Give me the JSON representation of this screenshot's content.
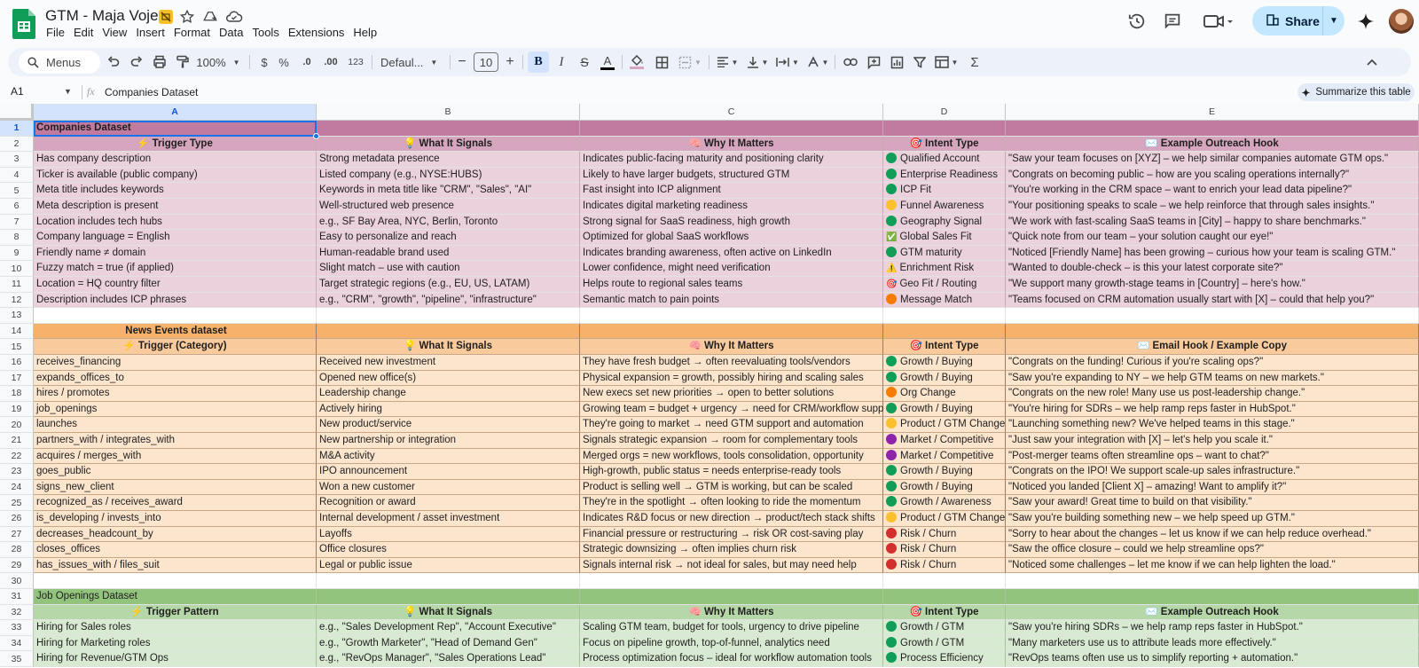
{
  "app": {
    "doc_title": "GTM - Maja Voje",
    "menu": [
      "File",
      "Edit",
      "View",
      "Insert",
      "Format",
      "Data",
      "Tools",
      "Extensions",
      "Help"
    ],
    "share_label": "Share"
  },
  "toolbar": {
    "search_label": "Menus",
    "zoom": "100%",
    "currency": "$",
    "percent": "%",
    "dec_decrease": ".0",
    "dec_increase": ".00",
    "number_format": "123",
    "font_name": "Defaul...",
    "font_size": "10",
    "bold": "B",
    "italic": "I",
    "strike": "S",
    "text_color": "A"
  },
  "formula_bar": {
    "cell_ref": "A1",
    "fx": "fx",
    "content": "Companies Dataset",
    "summarize_label": "Summarize this table"
  },
  "columns": [
    "A",
    "B",
    "C",
    "D",
    "E"
  ],
  "colors": {
    "green_dot": "#0f9d58",
    "orange_dot": "#f57c00",
    "yellow_dot": "#fbc02d",
    "purple_dot": "#8e24aa",
    "red_dot": "#d32f2f",
    "selection": "#1a73e8"
  },
  "rows": [
    {
      "n": "1",
      "style": "sec-pink title",
      "cells": [
        "Companies Dataset",
        "",
        "",
        "",
        ""
      ],
      "bold_first": true
    },
    {
      "n": "2",
      "style": "sec-pink head",
      "cells": [
        "⚡ Trigger Type",
        "💡 What It Signals",
        "🧠 Why It Matters",
        "🎯 Intent Type",
        "✉️ Example Outreach Hook"
      ],
      "header": true
    },
    {
      "n": "3",
      "style": "sec-pink",
      "cells": [
        "Has company description",
        "Strong metadata presence",
        "Indicates public-facing maturity and positioning clarity",
        "Qualified Account",
        "\"Saw your team focuses on [XYZ] – we help similar companies automate GTM ops.\""
      ],
      "dot": "green"
    },
    {
      "n": "4",
      "style": "sec-pink",
      "cells": [
        "Ticker is available (public company)",
        "Listed company (e.g., NYSE:HUBS)",
        "Likely to have larger budgets, structured GTM",
        "Enterprise Readiness",
        "\"Congrats on becoming public – how are you scaling operations internally?\""
      ],
      "dot": "green"
    },
    {
      "n": "5",
      "style": "sec-pink",
      "cells": [
        "Meta title includes keywords",
        "Keywords in meta title like \"CRM\", \"Sales\", \"AI\"",
        "Fast insight into ICP alignment",
        "ICP Fit",
        "\"You're working in the CRM space – want to enrich your lead data pipeline?\""
      ],
      "dot": "green"
    },
    {
      "n": "6",
      "style": "sec-pink",
      "cells": [
        "Meta description is present",
        "Well-structured web presence",
        "Indicates digital marketing readiness",
        "Funnel Awareness",
        "\"Your positioning speaks to scale – we help reinforce that through sales insights.\""
      ],
      "dot": "yellow"
    },
    {
      "n": "7",
      "style": "sec-pink",
      "cells": [
        "Location includes tech hubs",
        "e.g., SF Bay Area, NYC, Berlin, Toronto",
        "Strong signal for SaaS readiness, high growth",
        "Geography Signal",
        "\"We work with fast-scaling SaaS teams in [City] – happy to share benchmarks.\""
      ],
      "dot": "green"
    },
    {
      "n": "8",
      "style": "sec-pink",
      "cells": [
        "Company language = English",
        "Easy to personalize and reach",
        "Optimized for global SaaS workflows",
        "Global Sales Fit",
        "\"Quick note from our team – your solution caught our eye!\""
      ],
      "emoji": "✅"
    },
    {
      "n": "9",
      "style": "sec-pink",
      "cells": [
        "Friendly name ≠ domain",
        "Human-readable brand used",
        "Indicates branding awareness, often active on LinkedIn",
        "GTM maturity",
        "\"Noticed [Friendly Name] has been growing – curious how your team is scaling GTM.\""
      ],
      "dot": "green"
    },
    {
      "n": "10",
      "style": "sec-pink",
      "cells": [
        "Fuzzy match = true (if applied)",
        "Slight match – use with caution",
        "Lower confidence, might need verification",
        "Enrichment Risk",
        "\"Wanted to double-check – is this your latest corporate site?\""
      ],
      "emoji": "⚠️"
    },
    {
      "n": "11",
      "style": "sec-pink",
      "cells": [
        "Location = HQ country filter",
        "Target strategic regions (e.g., EU, US, LATAM)",
        "Helps route to regional sales teams",
        "Geo Fit / Routing",
        "\"We support many growth-stage teams in [Country] – here's how.\""
      ],
      "emoji": "🎯"
    },
    {
      "n": "12",
      "style": "sec-pink",
      "cells": [
        "Description includes ICP phrases",
        "e.g., \"CRM\", \"growth\", \"pipeline\", \"infrastructure\"",
        "Semantic match to pain points",
        "Message Match",
        "\"Teams focused on CRM automation usually start with [X] – could that help you?\""
      ],
      "dot": "orange"
    },
    {
      "n": "13",
      "style": "blank",
      "cells": [
        "",
        "",
        "",
        "",
        ""
      ]
    },
    {
      "n": "14",
      "style": "sec-orange title",
      "cells": [
        "News Events dataset",
        "",
        "",
        "",
        ""
      ],
      "title_center": true
    },
    {
      "n": "15",
      "style": "sec-orange head",
      "cells": [
        "⚡ Trigger (Category)",
        "💡 What It Signals",
        "🧠 Why It Matters",
        "🎯 Intent Type",
        "✉️ Email Hook / Example Copy"
      ],
      "header": true
    },
    {
      "n": "16",
      "style": "sec-orange",
      "cells": [
        "receives_financing",
        "Received new investment",
        "They have fresh budget → often reevaluating tools/vendors",
        "Growth / Buying",
        "\"Congrats on the funding! Curious if you're scaling ops?\""
      ],
      "dot": "green"
    },
    {
      "n": "17",
      "style": "sec-orange",
      "cells": [
        "expands_offices_to",
        "Opened new office(s)",
        "Physical expansion = growth, possibly hiring and scaling sales",
        "Growth / Buying",
        "\"Saw you're expanding to NY – we help GTM teams on new markets.\""
      ],
      "dot": "green"
    },
    {
      "n": "18",
      "style": "sec-orange",
      "cells": [
        "hires / promotes",
        "Leadership change",
        "New execs set new priorities → open to better solutions",
        "Org Change",
        "\"Congrats on the new role! Many use us post-leadership change.\""
      ],
      "dot": "orange"
    },
    {
      "n": "19",
      "style": "sec-orange",
      "cells": [
        "job_openings",
        "Actively hiring",
        "Growing team = budget + urgency → need for CRM/workflow support",
        "Growth / Buying",
        "\"You're hiring for SDRs – we help ramp reps faster in HubSpot.\""
      ],
      "dot": "green"
    },
    {
      "n": "20",
      "style": "sec-orange",
      "cells": [
        "launches",
        "New product/service",
        "They're going to market → need GTM support and automation",
        "Product / GTM Change",
        "\"Launching something new? We've helped teams in this stage.\""
      ],
      "dot": "yellow"
    },
    {
      "n": "21",
      "style": "sec-orange",
      "cells": [
        "partners_with / integrates_with",
        "New partnership or integration",
        "Signals strategic expansion → room for complementary tools",
        "Market / Competitive",
        "\"Just saw your integration with [X] – let's help you scale it.\""
      ],
      "dot": "purple"
    },
    {
      "n": "22",
      "style": "sec-orange",
      "cells": [
        "acquires / merges_with",
        "M&A activity",
        "Merged orgs = new workflows, tools consolidation, opportunity",
        "Market / Competitive",
        "\"Post-merger teams often streamline ops – want to chat?\""
      ],
      "dot": "purple"
    },
    {
      "n": "23",
      "style": "sec-orange",
      "cells": [
        "goes_public",
        "IPO announcement",
        "High-growth, public status = needs enterprise-ready tools",
        "Growth / Buying",
        "\"Congrats on the IPO! We support scale-up sales infrastructure.\""
      ],
      "dot": "green"
    },
    {
      "n": "24",
      "style": "sec-orange",
      "cells": [
        "signs_new_client",
        "Won a new customer",
        "Product is selling well → GTM is working, but can be scaled",
        "Growth / Buying",
        "\"Noticed you landed [Client X] – amazing! Want to amplify it?\""
      ],
      "dot": "green"
    },
    {
      "n": "25",
      "style": "sec-orange",
      "cells": [
        "recognized_as / receives_award",
        "Recognition or award",
        "They're in the spotlight → often looking to ride the momentum",
        "Growth / Awareness",
        "\"Saw your award! Great time to build on that visibility.\""
      ],
      "dot": "green"
    },
    {
      "n": "26",
      "style": "sec-orange",
      "cells": [
        "is_developing / invests_into",
        "Internal development / asset investment",
        "Indicates R&D focus or new direction → product/tech stack shifts",
        "Product / GTM Change",
        "\"Saw you're building something new – we help speed up GTM.\""
      ],
      "dot": "yellow"
    },
    {
      "n": "27",
      "style": "sec-orange",
      "cells": [
        "decreases_headcount_by",
        "Layoffs",
        "Financial pressure or restructuring → risk OR cost-saving play",
        "Risk / Churn",
        "\"Sorry to hear about the changes – let us know if we can help reduce overhead.\""
      ],
      "dot": "red"
    },
    {
      "n": "28",
      "style": "sec-orange",
      "cells": [
        "closes_offices",
        "Office closures",
        "Strategic downsizing → often implies churn risk",
        "Risk / Churn",
        "\"Saw the office closure – could we help streamline ops?\""
      ],
      "dot": "red"
    },
    {
      "n": "29",
      "style": "sec-orange",
      "cells": [
        "has_issues_with / files_suit",
        "Legal or public issue",
        "Signals internal risk → not ideal for sales, but may need help",
        "Risk / Churn",
        "\"Noticed some challenges – let me know if we can help lighten the load.\""
      ],
      "dot": "red"
    },
    {
      "n": "30",
      "style": "blank",
      "cells": [
        "",
        "",
        "",
        "",
        ""
      ]
    },
    {
      "n": "31",
      "style": "sec-green title",
      "cells": [
        "Job Openings Dataset",
        "",
        "",
        "",
        ""
      ]
    },
    {
      "n": "32",
      "style": "sec-green head",
      "cells": [
        "⚡ Trigger Pattern",
        "💡 What It Signals",
        "🧠 Why It Matters",
        "🎯 Intent Type",
        "✉️ Example Outreach Hook"
      ],
      "header": true
    },
    {
      "n": "33",
      "style": "sec-green",
      "cells": [
        "Hiring for Sales roles",
        "e.g., \"Sales Development Rep\", \"Account Executive\"",
        "Scaling GTM team, budget for tools, urgency to drive pipeline",
        "Growth / GTM",
        "\"Saw you're hiring SDRs – we help ramp reps faster in HubSpot.\""
      ],
      "dot": "green"
    },
    {
      "n": "34",
      "style": "sec-green",
      "cells": [
        "Hiring for Marketing roles",
        "e.g., \"Growth Marketer\", \"Head of Demand Gen\"",
        "Focus on pipeline growth, top-of-funnel, analytics need",
        "Growth / GTM",
        "\"Many marketers use us to attribute leads more effectively.\""
      ],
      "dot": "green"
    },
    {
      "n": "35",
      "style": "sec-green",
      "cells": [
        "Hiring for Revenue/GTM Ops",
        "e.g., \"RevOps Manager\", \"Sales Operations Lead\"",
        "Process optimization focus – ideal for workflow automation tools",
        "Process Efficiency",
        "\"RevOps teams often use us to simplify reporting + automation.\""
      ],
      "dot": "green"
    }
  ]
}
